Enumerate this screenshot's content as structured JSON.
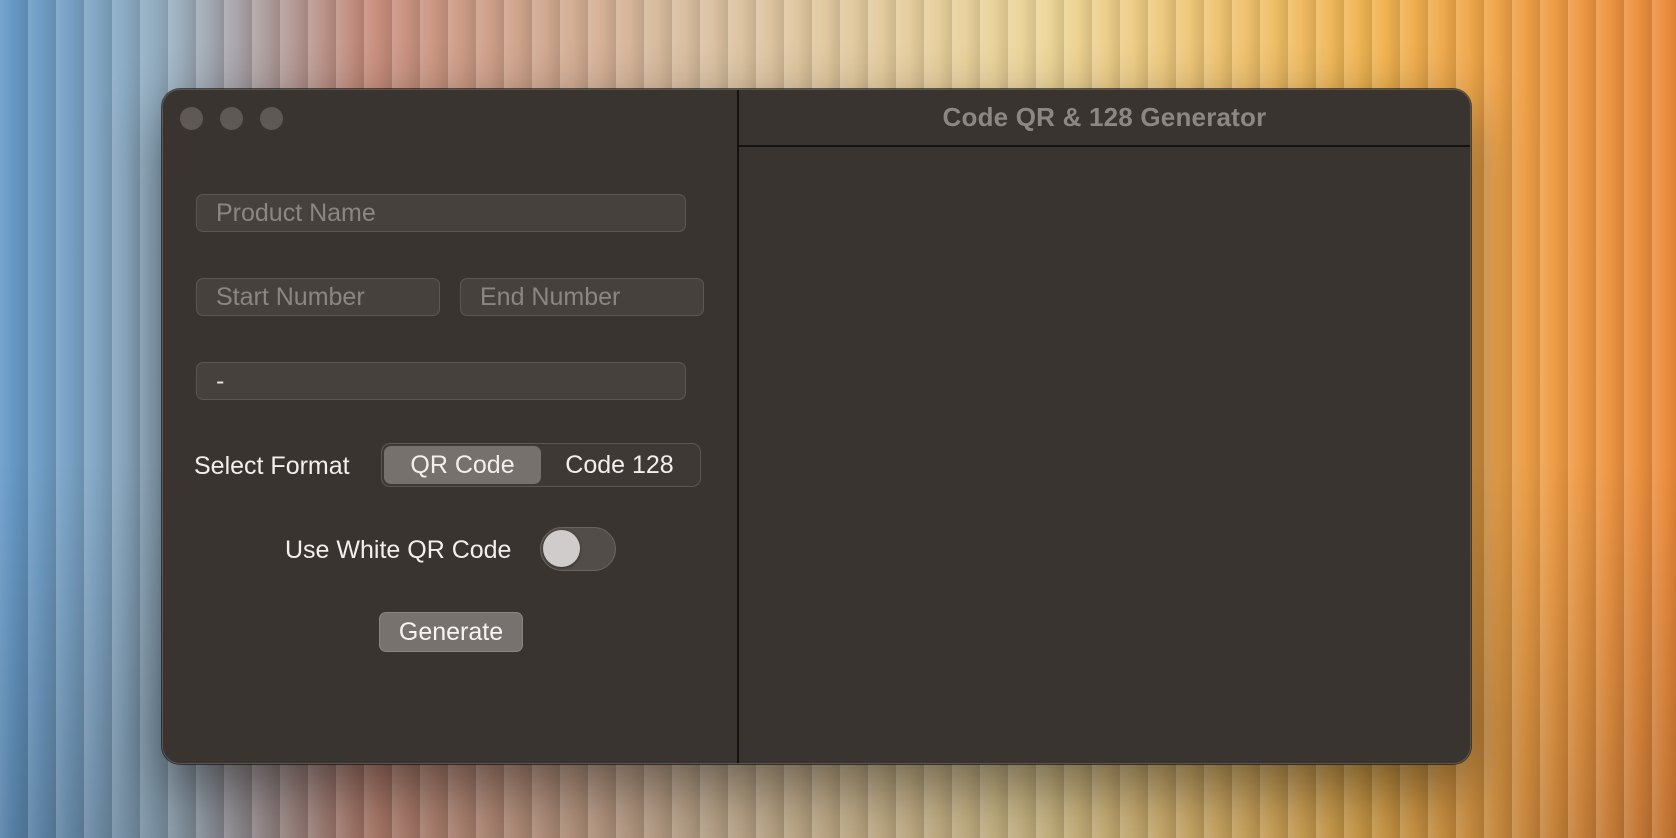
{
  "window": {
    "title": "Code QR & 128 Generator"
  },
  "form": {
    "product_name": {
      "placeholder": "Product Name",
      "value": ""
    },
    "start_number": {
      "placeholder": "Start Number",
      "value": ""
    },
    "end_number": {
      "placeholder": "End Number",
      "value": ""
    },
    "separator": {
      "value": "-"
    },
    "format": {
      "label": "Select Format",
      "options": [
        "QR Code",
        "Code 128"
      ],
      "selected": "QR Code"
    },
    "white_qr": {
      "label": "Use White QR Code",
      "enabled": false
    },
    "generate_label": "Generate"
  },
  "colors": {
    "window_bg": "#393430",
    "selected_segment": "#76716c",
    "button_bg": "#77726d"
  },
  "icons": {
    "close": "close-icon",
    "minimize": "minimize-icon",
    "zoom": "zoom-icon"
  }
}
